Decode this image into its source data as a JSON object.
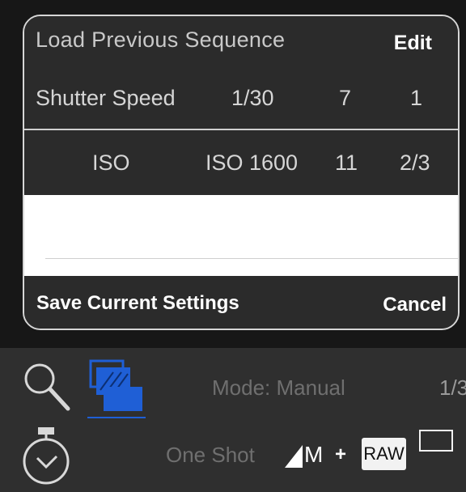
{
  "dialog": {
    "title": "Load Previous Sequence",
    "edit_label": "Edit",
    "rows": [
      {
        "name": "Shutter Speed",
        "value": "1/30",
        "count": "7",
        "step": "1"
      },
      {
        "name": "ISO",
        "value": "ISO 1600",
        "count": "11",
        "step": "2/3"
      }
    ],
    "save_label": "Save Current Settings",
    "cancel_label": "Cancel"
  },
  "toolbar": {
    "mode": "Mode: Manual",
    "shutter_partial": "1/3",
    "drive_mode": "One Shot",
    "quality": "M",
    "plus": "+",
    "raw": "RAW"
  },
  "icons": [
    "search-icon",
    "sequence-icon",
    "timer-icon",
    "quality-icon",
    "aspect-ratio-icon"
  ],
  "colors": {
    "accent_blue": "#1f5fd6"
  }
}
